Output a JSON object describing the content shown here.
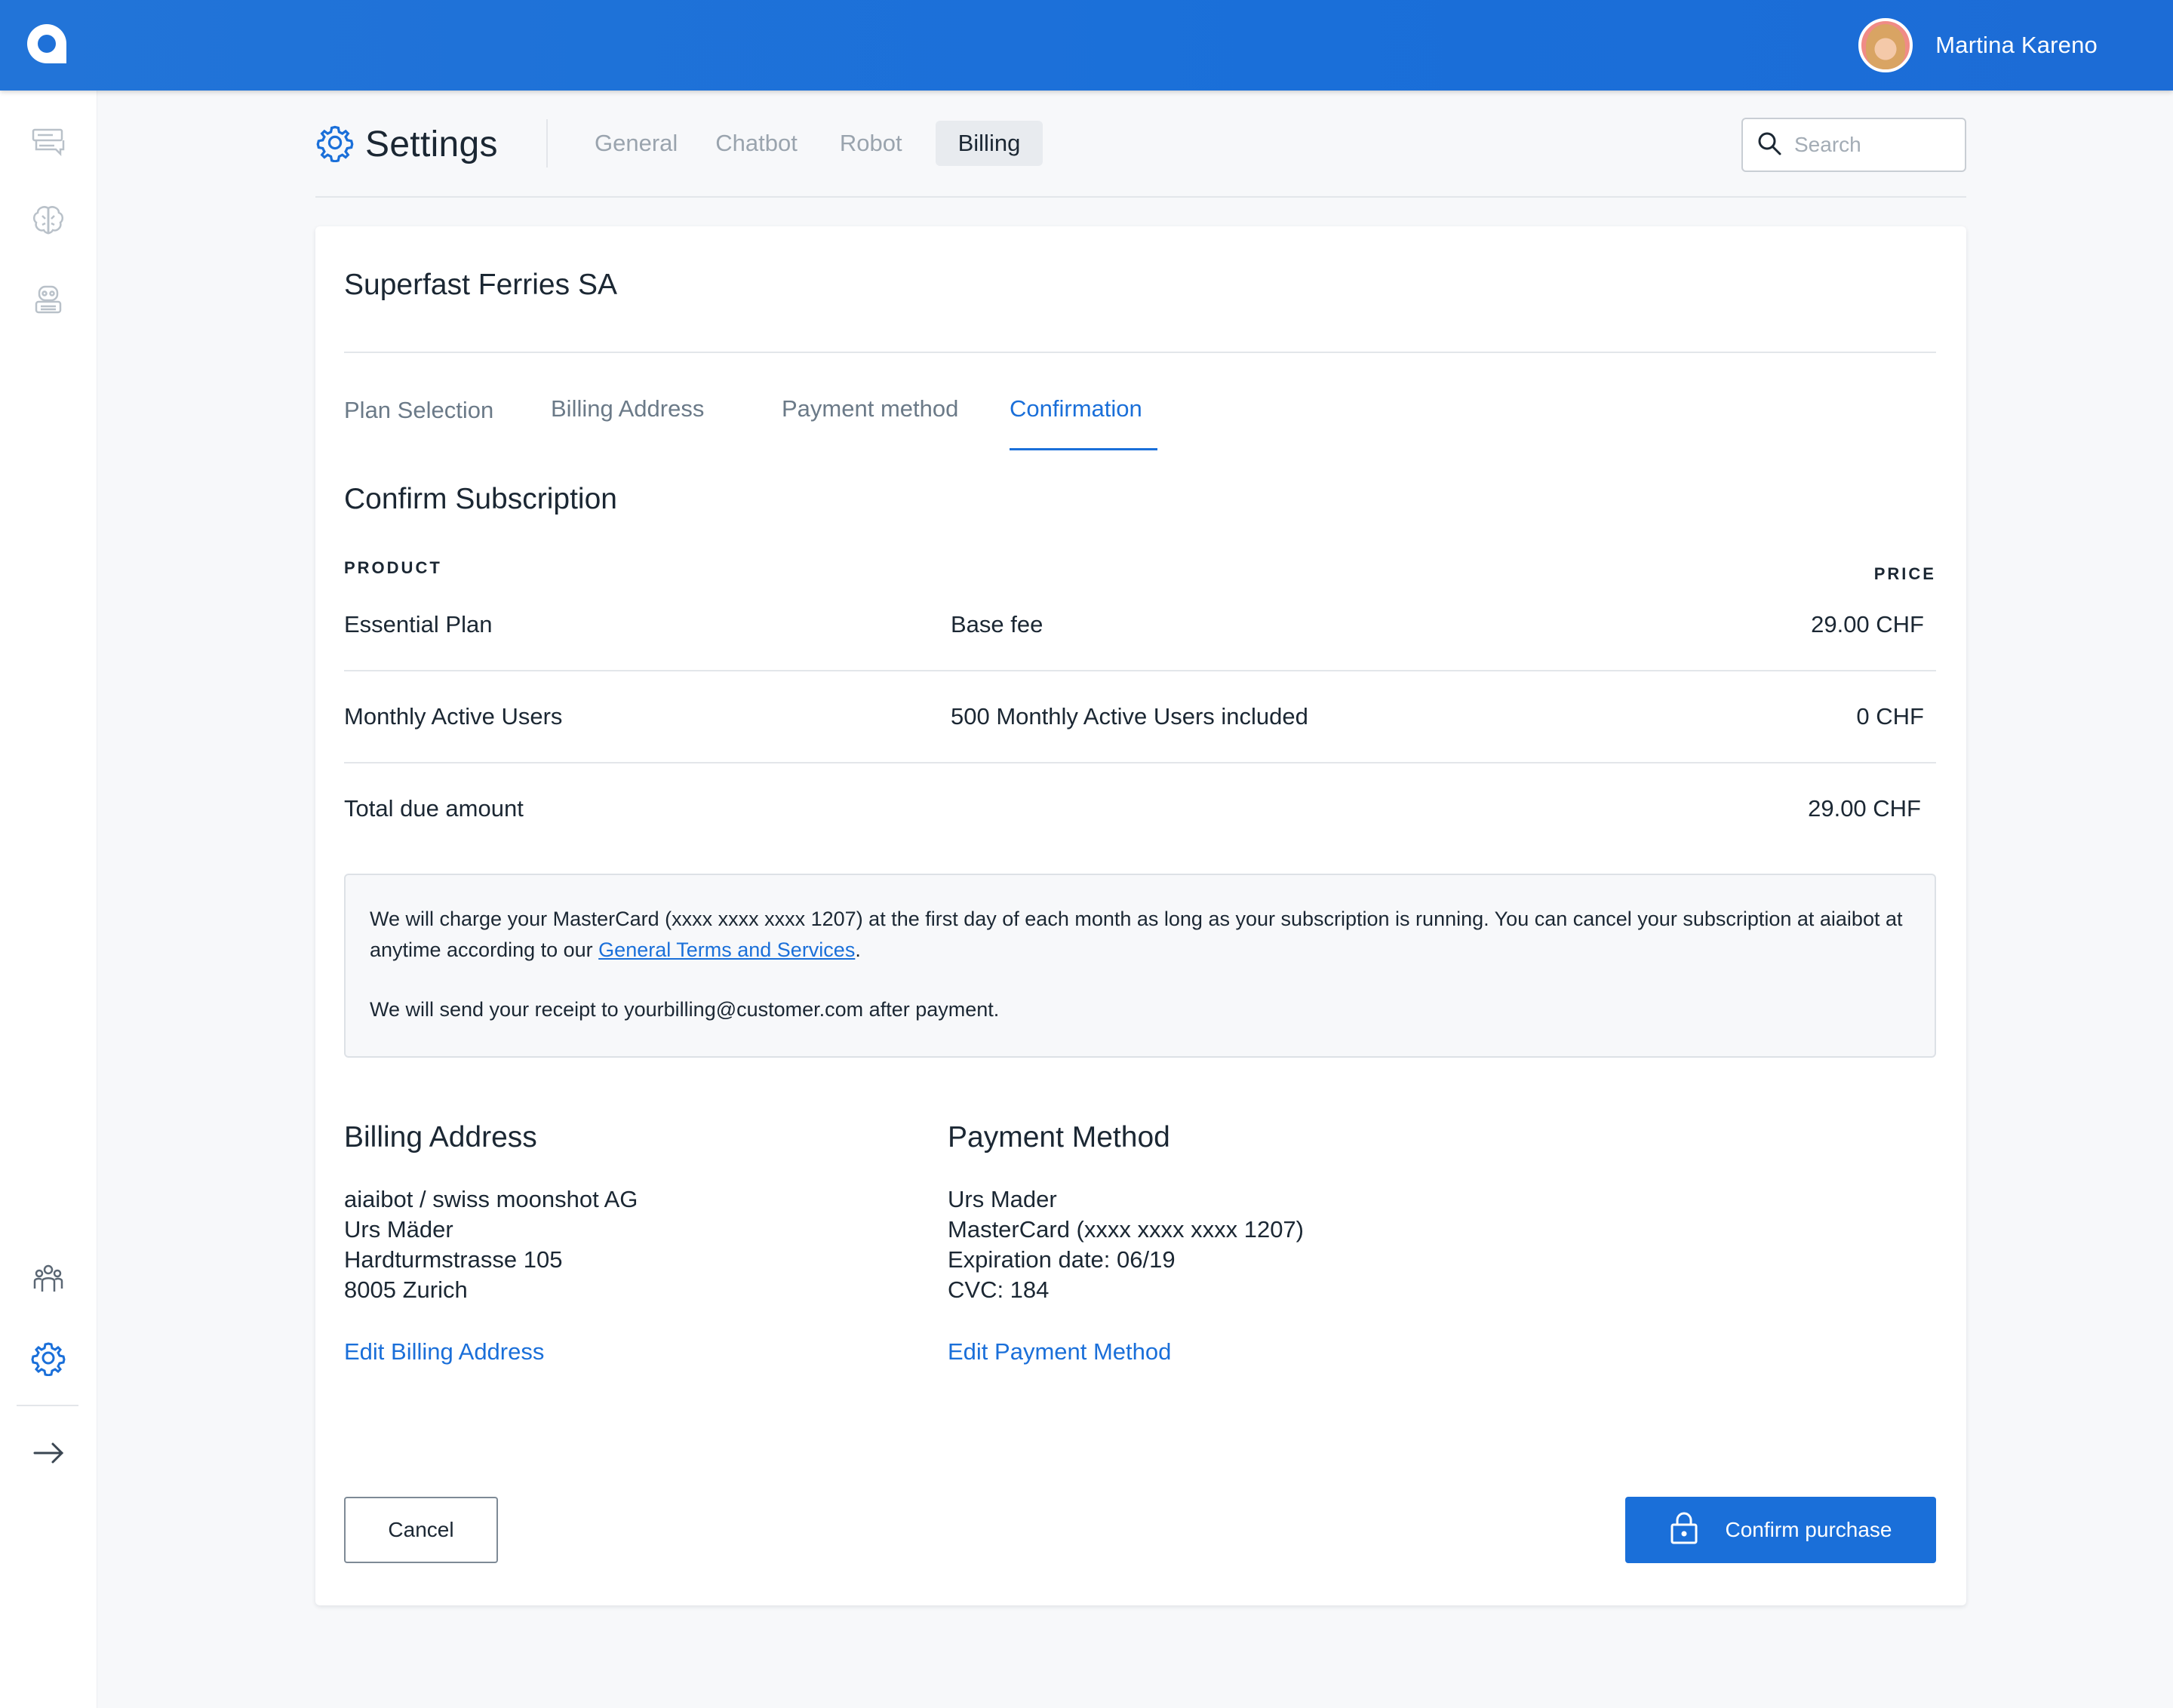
{
  "header": {
    "logo_icon": "aiaibot-logo-icon",
    "user_name": "Martina Kareno",
    "avatar_icon": "user-avatar"
  },
  "sidebar": {
    "items": [
      {
        "icon": "conversations-icon",
        "label": ""
      },
      {
        "icon": "brain-icon",
        "label": ""
      },
      {
        "icon": "robot-icon",
        "label": ""
      },
      {
        "icon": "team-icon",
        "label": ""
      },
      {
        "icon": "settings-icon",
        "label": ""
      },
      {
        "icon": "arrow-right-icon",
        "label": ""
      }
    ]
  },
  "page": {
    "title": "Settings",
    "tabs": [
      "General",
      "Chatbot",
      "Robot",
      "Billing"
    ],
    "active_tab": "Billing",
    "search_placeholder": "Search"
  },
  "billing": {
    "company": "Superfast Ferries SA",
    "steps": [
      "Plan Selection",
      "Billing Address",
      "Payment method",
      "Confirmation"
    ],
    "active_step": "Confirmation",
    "confirm_title": "Confirm Subscription",
    "col_product": "PRODUCT",
    "col_price": "PRICE",
    "rows": [
      {
        "product": "Essential Plan",
        "description": "Base fee",
        "price": "29.00 CHF"
      },
      {
        "product": "Monthly Active Users",
        "description": "500 Monthly Active Users included",
        "price": "0 CHF"
      }
    ],
    "total_label": "Total due amount",
    "total_price": "29.00 CHF",
    "notice": {
      "text_before": "We will charge your MasterCard (xxxx xxxx xxxx 1207) at the first day of each month as long as your subscription is running. You can cancel your subscription at aiaibot at anytime according to our ",
      "link_text": "General Terms and Services",
      "text_after": ".",
      "receipt": "We will send your receipt to yourbilling@customer.com after payment."
    },
    "billing_address": {
      "title": "Billing Address",
      "lines": [
        "aiaibot / swiss moonshot AG",
        "Urs Mäder",
        "Hardturmstrasse 105",
        "8005 Zurich"
      ],
      "edit_label": "Edit Billing Address"
    },
    "payment_method": {
      "title": "Payment Method",
      "lines": [
        "Urs Mader",
        "MasterCard (xxxx xxxx xxxx 1207)",
        "Expiration date: 06/19",
        "CVC: 184"
      ],
      "edit_label": "Edit Payment Method"
    },
    "cancel_label": "Cancel",
    "confirm_label": "Confirm purchase"
  },
  "colors": {
    "brand_blue": "#1a6fd9",
    "text_dark": "#1b2733",
    "text_muted": "#9aa4ae"
  }
}
